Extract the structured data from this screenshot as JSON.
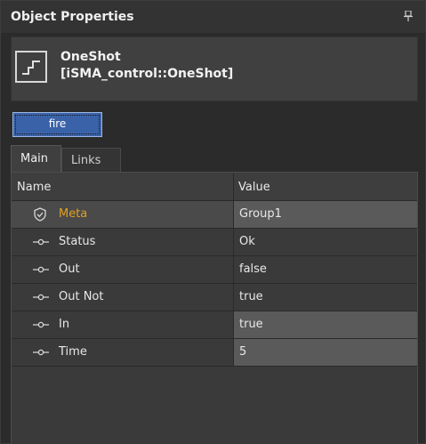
{
  "panel": {
    "title": "Object Properties",
    "pin_glyph": "⊥"
  },
  "object": {
    "name": "OneShot",
    "type": "[iSMA_control::OneShot]",
    "icon": "oneshot-pulse-icon"
  },
  "actions": {
    "fire_label": "fire"
  },
  "tabs": [
    {
      "label": "Main",
      "active": true
    },
    {
      "label": "Links",
      "active": false
    }
  ],
  "grid": {
    "col_name": "Name",
    "col_value": "Value",
    "rows": [
      {
        "name": "Meta",
        "value": "Group1",
        "icon": "shield-check-icon"
      },
      {
        "name": "Status",
        "value": "Ok",
        "icon": "slot-pin-icon"
      },
      {
        "name": "Out",
        "value": "false",
        "icon": "slot-pin-icon"
      },
      {
        "name": "Out Not",
        "value": "true",
        "icon": "slot-pin-icon"
      },
      {
        "name": "In",
        "value": "true",
        "icon": "slot-pin-icon"
      },
      {
        "name": "Time",
        "value": "5",
        "icon": "slot-pin-icon"
      }
    ]
  },
  "colors": {
    "accent": "#3a62a8",
    "meta_label": "#e0a020",
    "background": "#2b2b2b"
  }
}
